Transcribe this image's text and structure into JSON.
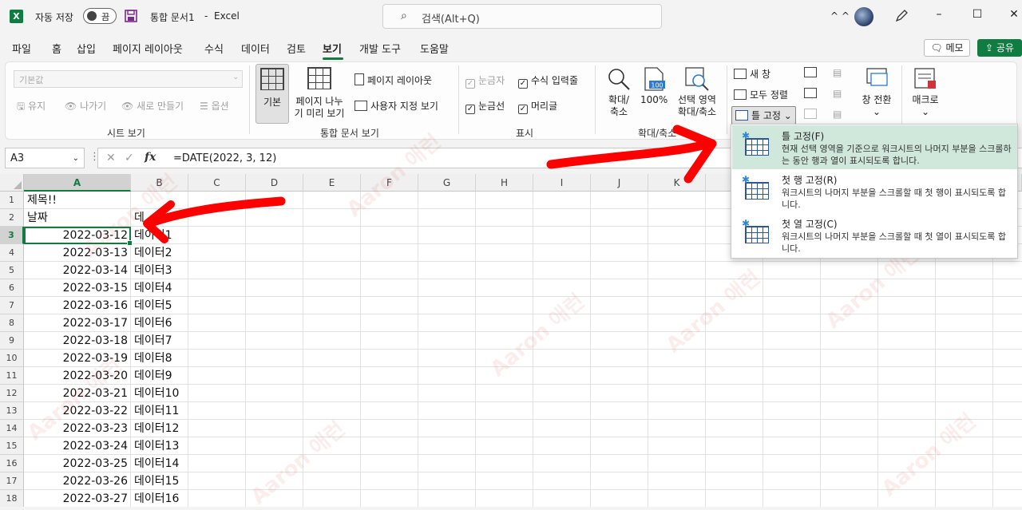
{
  "titlebar": {
    "app_logo": "X",
    "autosave_label": "자동 저장",
    "autosave_state": "끔",
    "doc_title": "통합 문서1",
    "separator": "-",
    "app_name": "Excel",
    "search_placeholder": "검색(Alt+Q)",
    "caret_glyph": "^ ^"
  },
  "tabs": [
    "파일",
    "홈",
    "삽입",
    "페이지 레이아웃",
    "수식",
    "데이터",
    "검토",
    "보기",
    "개발 도구",
    "도움말"
  ],
  "active_tab": "보기",
  "header_buttons": {
    "memo": "메모",
    "share": "공유"
  },
  "ribbon": {
    "sheet_view": {
      "combo": "기본값",
      "keep": "유지",
      "exit": "나가기",
      "new": "새로 만들기",
      "options": "옵션",
      "label": "시트 보기"
    },
    "workbook_view": {
      "normal": "기본",
      "page_break_1": "페이지 나누",
      "page_break_2": "기 미리 보기",
      "page_layout": "페이지 레이아웃",
      "custom_view": "사용자 지정 보기",
      "label": "통합 문서 보기"
    },
    "show": {
      "ruler": "눈금자",
      "formula_bar": "수식 입력줄",
      "gridlines": "눈금선",
      "headings": "머리글",
      "label": "표시"
    },
    "zoom": {
      "zoom_1": "확대/",
      "zoom_2": "축소",
      "percent": "100%",
      "hundred_icon_text": "100",
      "selection_1": "선택 영역",
      "selection_2": "확대/축소",
      "label": "확대/축소"
    },
    "window": {
      "new_window": "새 창",
      "arrange_all": "모두 정렬",
      "freeze_panes": "틀 고정",
      "switch_1": "창 전환",
      "switch_2": "⌄"
    },
    "macros": {
      "label_1": "매크로",
      "label_2": "⌄"
    }
  },
  "formula_bar": {
    "name_box": "A3",
    "formula": "=DATE(2022, 3, 12)",
    "fx": "fx"
  },
  "columns": [
    "A",
    "B",
    "C",
    "D",
    "E",
    "F",
    "G",
    "H",
    "I",
    "J",
    "K"
  ],
  "rows": [
    "1",
    "2",
    "3",
    "4",
    "5",
    "6",
    "7",
    "8",
    "9",
    "10",
    "11",
    "12",
    "13",
    "14",
    "15",
    "16",
    "17",
    "18"
  ],
  "selected_cell": "A3",
  "cells": {
    "a1": "제목!!",
    "a2": "날짜",
    "b2": "데",
    "data_rows": [
      {
        "date": "2022-03-12",
        "value": "데이터1"
      },
      {
        "date": "2022-03-13",
        "value": "데이터2"
      },
      {
        "date": "2022-03-14",
        "value": "데이터3"
      },
      {
        "date": "2022-03-15",
        "value": "데이터4"
      },
      {
        "date": "2022-03-16",
        "value": "데이터5"
      },
      {
        "date": "2022-03-17",
        "value": "데이터6"
      },
      {
        "date": "2022-03-18",
        "value": "데이터7"
      },
      {
        "date": "2022-03-19",
        "value": "데이터8"
      },
      {
        "date": "2022-03-20",
        "value": "데이터9"
      },
      {
        "date": "2022-03-21",
        "value": "데이터10"
      },
      {
        "date": "2022-03-22",
        "value": "데이터11"
      },
      {
        "date": "2022-03-23",
        "value": "데이터12"
      },
      {
        "date": "2022-03-24",
        "value": "데이터13"
      },
      {
        "date": "2022-03-25",
        "value": "데이터14"
      },
      {
        "date": "2022-03-26",
        "value": "데이터15"
      },
      {
        "date": "2022-03-27",
        "value": "데이터16"
      }
    ]
  },
  "freeze_menu": [
    {
      "title": "틀 고정(F)",
      "desc": "현재 선택 영역을 기준으로 워크시트의 나머지 부분을 스크롤하는 동안 행과 열이 표시되도록 합니다."
    },
    {
      "title": "첫 행 고정(R)",
      "desc": "워크시트의 나머지 부분을 스크롤할 때 첫 행이 표시되도록 합니다."
    },
    {
      "title": "첫 열 고정(C)",
      "desc": "워크시트의 나머지 부분을 스크롤할 때 첫 열이 표시되도록 합니다."
    }
  ],
  "watermark": "Aaron 애런",
  "colors": {
    "excel_green": "#107c41",
    "annotation_red": "#ff0000",
    "menu_highlight": "#cfe8db"
  }
}
